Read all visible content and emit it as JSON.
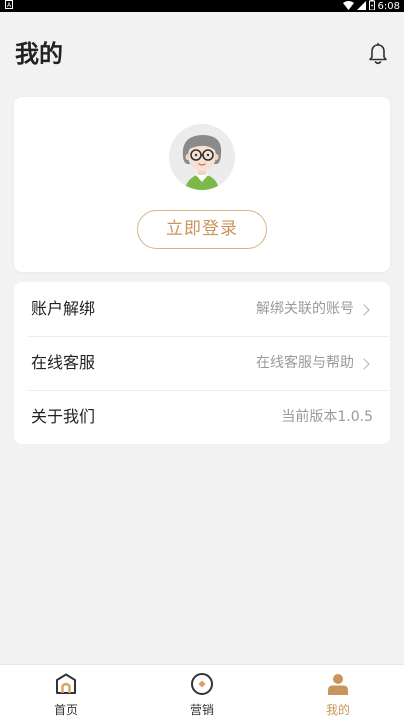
{
  "status_bar": {
    "time": "6:08",
    "left_icon": "notification-icon",
    "right_icons": [
      "wifi-icon",
      "signal-icon",
      "battery-icon"
    ]
  },
  "header": {
    "title": "我的",
    "bell_icon": "bell-icon"
  },
  "profile": {
    "avatar_icon": "avatar-illustration",
    "login_label": "立即登录"
  },
  "menu": [
    {
      "label": "账户解绑",
      "value": "解绑关联的账号",
      "has_chevron": true
    },
    {
      "label": "在线客服",
      "value": "在线客服与帮助",
      "has_chevron": true
    },
    {
      "label": "关于我们",
      "value": "当前版本1.0.5",
      "has_chevron": false
    }
  ],
  "bottom_nav": {
    "items": [
      {
        "label": "首页",
        "icon": "home-icon",
        "active": false
      },
      {
        "label": "营销",
        "icon": "compass-icon",
        "active": false
      },
      {
        "label": "我的",
        "icon": "profile-icon",
        "active": true
      }
    ]
  },
  "colors": {
    "accent": "#c8955c",
    "background": "#f2f2f2",
    "card": "#ffffff"
  }
}
